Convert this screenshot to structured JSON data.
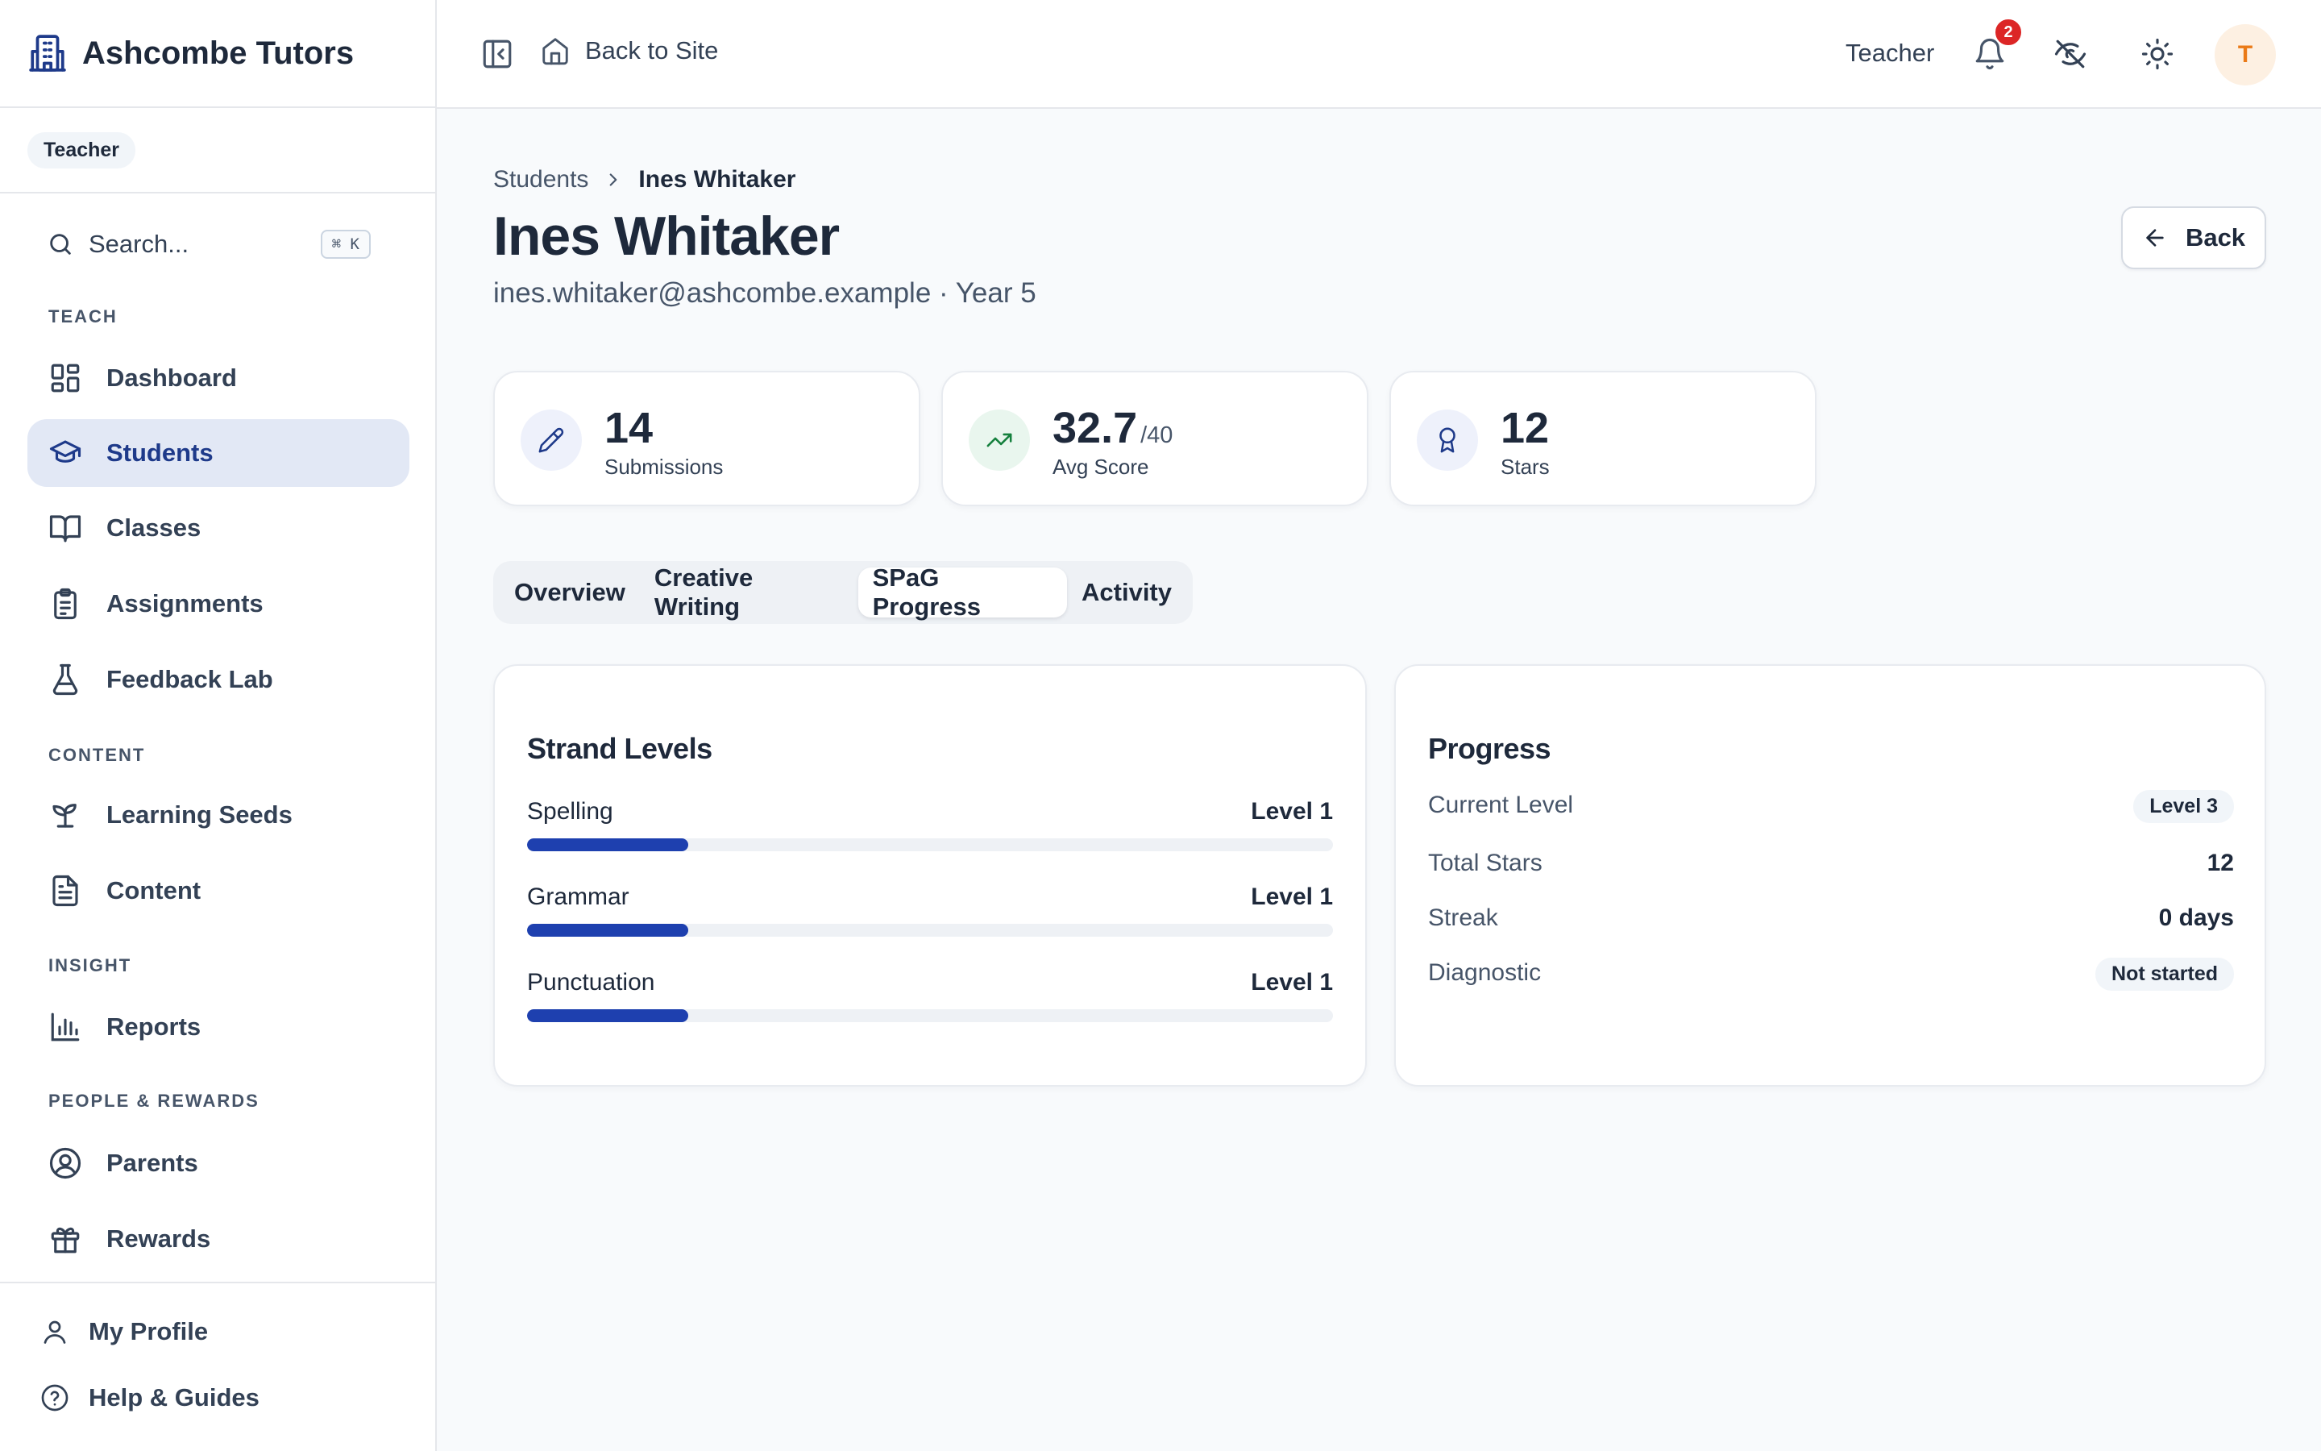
{
  "app": {
    "name": "Ashcombe Tutors",
    "logo_icon": "building-icon",
    "role_pill": "Teacher"
  },
  "sidebar": {
    "search": {
      "placeholder": "Search...",
      "shortcut": "⌘ K",
      "icon": "search-icon"
    },
    "sections": {
      "teach": "TEACH",
      "content": "CONTENT",
      "insight": "INSIGHT",
      "people": "PEOPLE & REWARDS"
    },
    "items": [
      {
        "label": "Dashboard",
        "icon": "dashboard-icon",
        "active": false
      },
      {
        "label": "Students",
        "icon": "graduation-cap-icon",
        "active": true
      },
      {
        "label": "Classes",
        "icon": "book-open-icon",
        "active": false
      },
      {
        "label": "Assignments",
        "icon": "clipboard-list-icon",
        "active": false
      },
      {
        "label": "Feedback Lab",
        "icon": "flask-icon",
        "active": false
      },
      {
        "label": "Learning Seeds",
        "icon": "sprout-icon",
        "active": false
      },
      {
        "label": "Content",
        "icon": "file-text-icon",
        "active": false
      },
      {
        "label": "Reports",
        "icon": "bar-chart-icon",
        "active": false
      },
      {
        "label": "Parents",
        "icon": "user-circle-icon",
        "active": false
      },
      {
        "label": "Rewards",
        "icon": "gift-icon",
        "active": false
      }
    ],
    "footer": [
      {
        "label": "My Profile",
        "icon": "user-icon"
      },
      {
        "label": "Help & Guides",
        "icon": "help-circle-icon"
      }
    ]
  },
  "topbar": {
    "back_to_site": "Back to Site",
    "role": "Teacher",
    "notifications_count": "2",
    "avatar_initial": "T"
  },
  "student": {
    "breadcrumb_parent": "Students",
    "name": "Ines Whitaker",
    "subtitle": "ines.whitaker@ashcombe.example · Year 5",
    "back_label": "Back"
  },
  "stats": [
    {
      "value": "14",
      "suffix": "",
      "label": "Submissions",
      "icon": "pencil-icon",
      "icon_color": "#1e3a8a",
      "icon_bg": "#eef1fb"
    },
    {
      "value": "32.7",
      "suffix": "/40",
      "label": "Avg Score",
      "icon": "trending-up-icon",
      "icon_color": "#15803d",
      "icon_bg": "#e9f6ee"
    },
    {
      "value": "12",
      "suffix": "",
      "label": "Stars",
      "icon": "award-icon",
      "icon_color": "#1e3a8a",
      "icon_bg": "#eef1fb"
    }
  ],
  "tabs": [
    {
      "label": "Overview",
      "active": false
    },
    {
      "label": "Creative Writing",
      "active": false
    },
    {
      "label": "SPaG Progress",
      "active": true
    },
    {
      "label": "Activity",
      "active": false
    }
  ],
  "strand_levels": {
    "title": "Strand Levels",
    "items": [
      {
        "name": "Spelling",
        "level": "Level 1",
        "progress": 0.2
      },
      {
        "name": "Grammar",
        "level": "Level 1",
        "progress": 0.2
      },
      {
        "name": "Punctuation",
        "level": "Level 1",
        "progress": 0.2
      }
    ],
    "bar_color": "#1e40af"
  },
  "progress": {
    "title": "Progress",
    "rows": [
      {
        "label": "Current Level",
        "value": "Level 3"
      },
      {
        "label": "Total Stars",
        "value": "12"
      },
      {
        "label": "Streak",
        "value": "0 days"
      },
      {
        "label": "Diagnostic",
        "value": "Not started"
      }
    ]
  }
}
